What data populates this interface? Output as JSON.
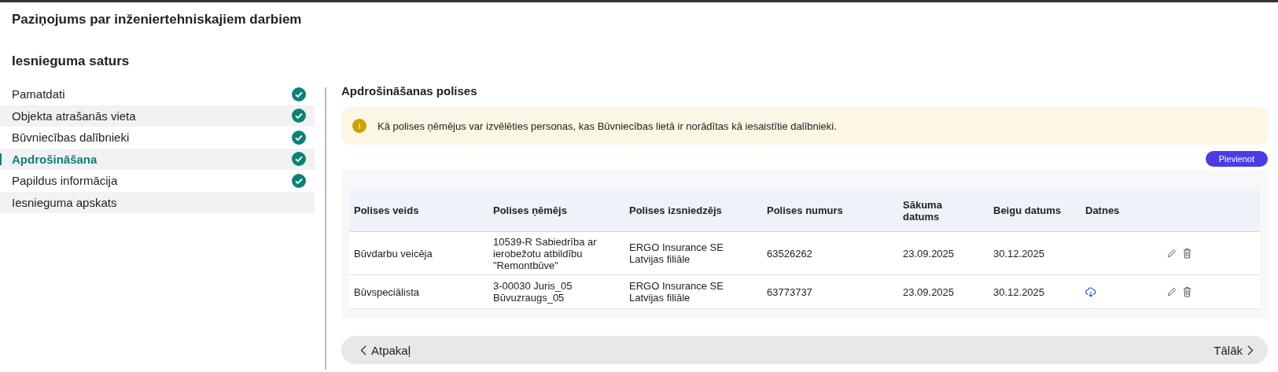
{
  "page_title": "Paziņojums par inženiertehniskajiem darbiem",
  "section_title": "Iesnieguma saturs",
  "sidebar": {
    "items": [
      {
        "label": "Pamatdati",
        "selected": false,
        "done": true
      },
      {
        "label": "Objekta atrašanās vieta",
        "selected": false,
        "done": true
      },
      {
        "label": "Būvniecības dalībnieki",
        "selected": false,
        "done": true
      },
      {
        "label": "Apdrošināšana",
        "selected": true,
        "done": true
      },
      {
        "label": "Papildus informācija",
        "selected": false,
        "done": true
      },
      {
        "label": "Iesnieguma apskats",
        "selected": false,
        "done": false
      }
    ]
  },
  "panel": {
    "title": "Apdrošināšanas polises",
    "notice": {
      "icon": "i",
      "text": "Kā polises ņēmējus var izvēlēties personas, kas Būvniecības lietā ir norādītas kā iesaistītie dalībnieki."
    },
    "add_button": "Pievienot",
    "table": {
      "columns": [
        "Polises veids",
        "Polises ņēmējs",
        "Polises izsniedzējs",
        "Polises numurs",
        "Sākuma datums",
        "Beigu datums",
        "Datnes"
      ],
      "rows": [
        {
          "cells": [
            "Būvdarbu veicēja",
            "10539-R Sabiedrība ar ierobežotu atbildību \"Remontbūve\"",
            "ERGO Insurance SE Latvijas filiāle",
            "63526262",
            "23.09.2025",
            "30.12.2025"
          ],
          "has_file": false
        },
        {
          "cells": [
            "Būvspeciālista",
            "3-00030 Juris_05 Būvuzraugs_05",
            "ERGO Insurance SE Latvijas filiāle",
            "63773737",
            "23.09.2025",
            "30.12.2025"
          ],
          "has_file": true
        }
      ]
    }
  },
  "footer": {
    "back": "Atpakaļ",
    "next": "Tālāk"
  }
}
